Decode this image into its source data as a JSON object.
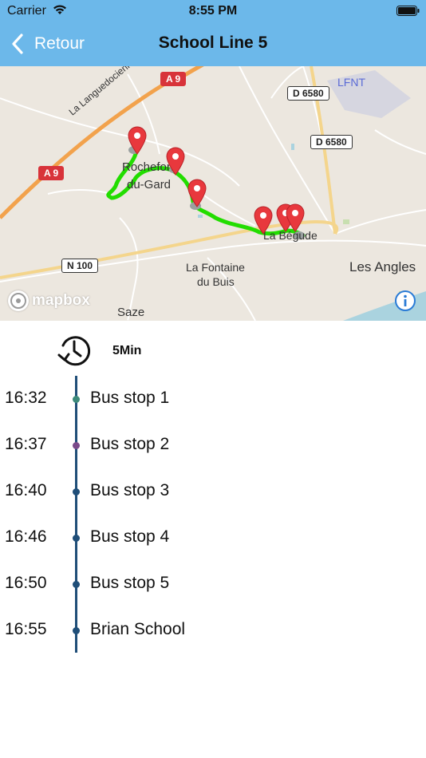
{
  "status_bar": {
    "carrier": "Carrier",
    "time": "8:55 PM"
  },
  "nav": {
    "back_label": "Retour",
    "title": "School Line 5"
  },
  "map": {
    "labels": {
      "la_languedocienne": "La Languedocienne",
      "lfnt": "LFNT",
      "rochefort_1": "Rochefort-",
      "rochefort_2": "du-Gard",
      "pujaut": "La Bégude",
      "fontaine_1": "La Fontaine",
      "fontaine_2": "du Buis",
      "les_angles": "Les Angles",
      "saze": "Saze"
    },
    "shields": {
      "a9_top": "A 9",
      "a9_left": "A 9",
      "d6580_top": "D 6580",
      "d6580_right": "D 6580",
      "n100": "N 100"
    },
    "attribution": "mapbox",
    "route_color": "#22dd00",
    "marker_color": "#e8383d"
  },
  "duration": {
    "label": "5Min"
  },
  "stops": [
    {
      "time": "16:32",
      "name": "Bus stop 1",
      "dot_color": "#3c8a7a"
    },
    {
      "time": "16:37",
      "name": "Bus stop 2",
      "dot_color": "#7a4a8a"
    },
    {
      "time": "16:40",
      "name": "Bus stop 3",
      "dot_color": "#1f4e78"
    },
    {
      "time": "16:46",
      "name": "Bus stop 4",
      "dot_color": "#1f4e78"
    },
    {
      "time": "16:50",
      "name": "Bus stop 5",
      "dot_color": "#1f4e78"
    },
    {
      "time": "16:55",
      "name": "Brian School",
      "dot_color": "#1f4e78"
    }
  ],
  "colors": {
    "header": "#6cb8ea",
    "timeline": "#1f4e78"
  }
}
